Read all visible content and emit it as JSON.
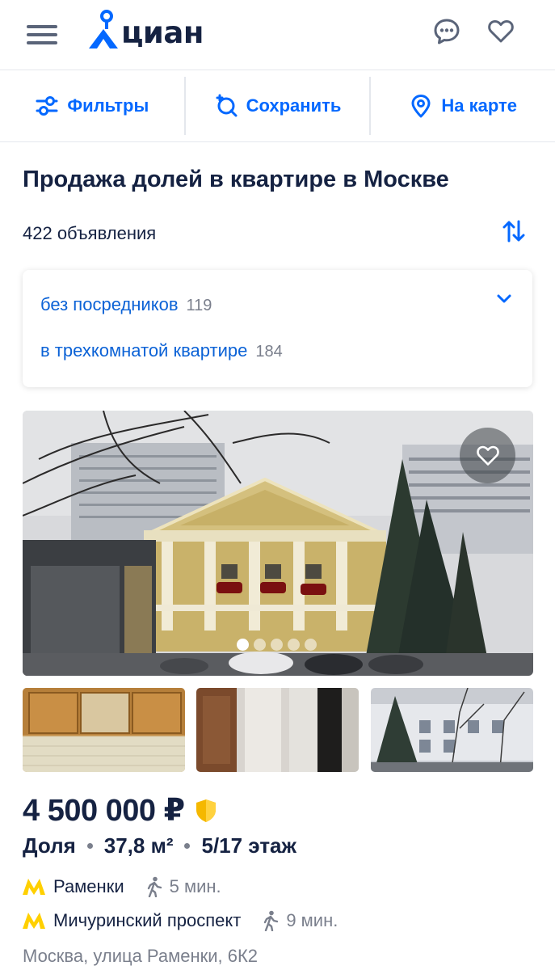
{
  "header": {
    "logo_text": "циан",
    "icons": [
      "menu-icon",
      "chat-icon",
      "heart-icon"
    ]
  },
  "actions": {
    "filters_label": "Фильтры",
    "save_label": "Сохранить",
    "map_label": "На карте"
  },
  "page": {
    "title": "Продажа долей в квартире в Москве",
    "count_text": "422 объявления"
  },
  "quick_filters": [
    {
      "label": "без посредников",
      "count": "119"
    },
    {
      "label": "в трехкомнатой квартире",
      "count": "184"
    }
  ],
  "listing": {
    "photo_count": 5,
    "active_photo_index": 0,
    "price": "4 500 000 ₽",
    "type": "Доля",
    "area": "37,8 м²",
    "floor": "5/17 этаж",
    "metro": [
      {
        "station": "Раменки",
        "time": "5 мин."
      },
      {
        "station": "Мичуринский проспект",
        "time": "9 мин."
      }
    ],
    "address": "Москва, улица Раменки, 6К2"
  },
  "colors": {
    "accent": "#0468ff",
    "text": "#152242",
    "muted": "#7a7f8c",
    "metro": "#ffd000"
  }
}
